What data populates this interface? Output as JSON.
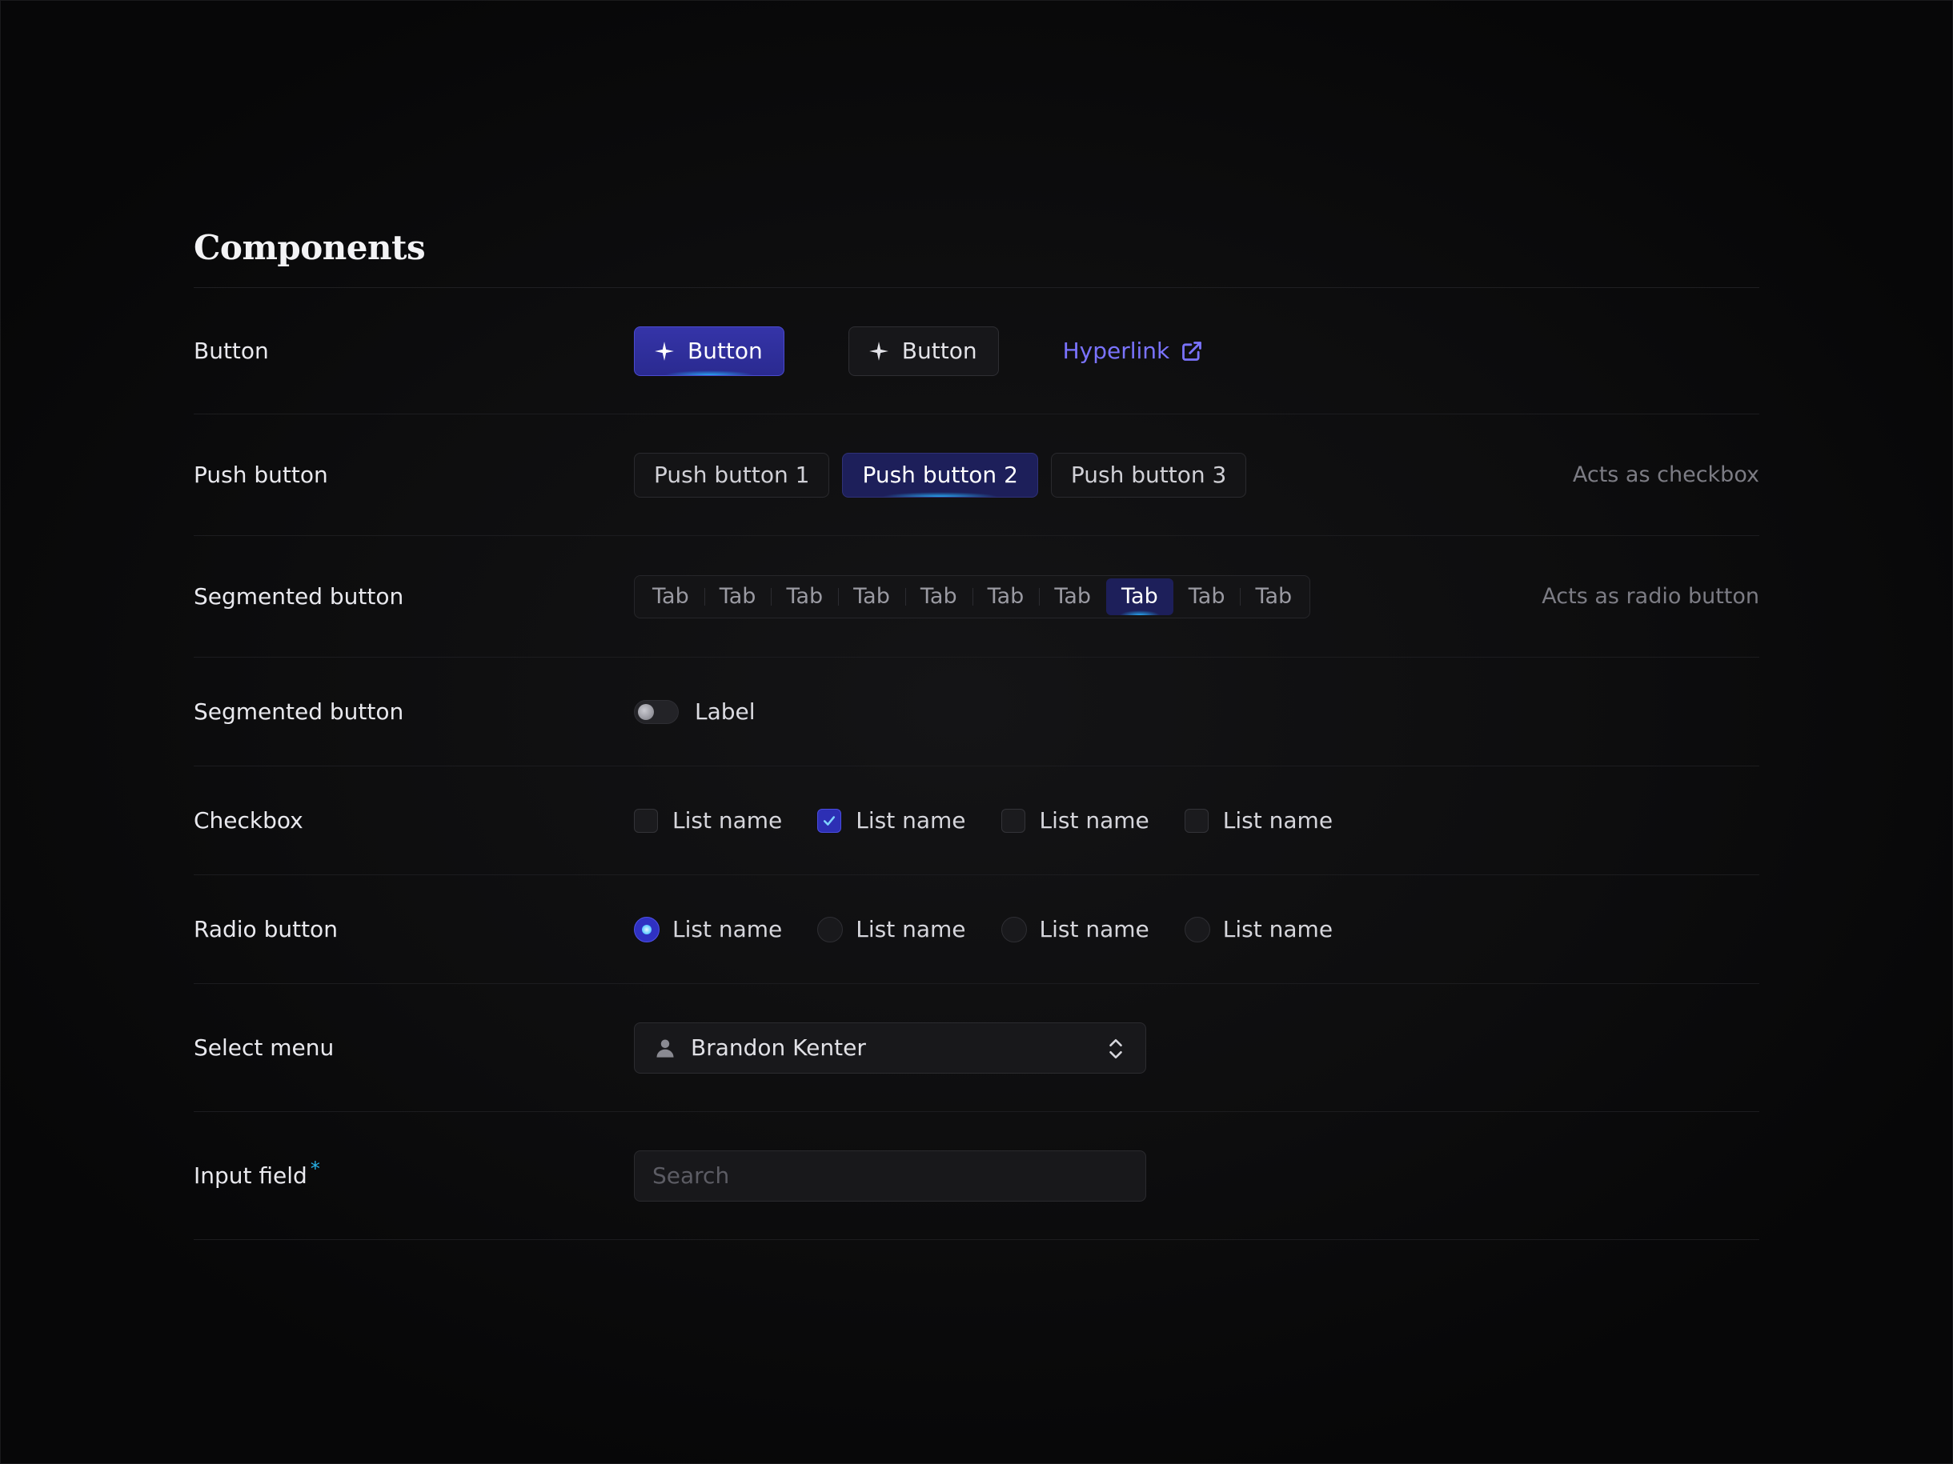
{
  "page": {
    "title": "Components"
  },
  "rows": {
    "button": {
      "label": "Button",
      "primary_label": "Button",
      "secondary_label": "Button",
      "link_label": "Hyperlink"
    },
    "push": {
      "label": "Push button",
      "items": [
        "Push button 1",
        "Push button 2",
        "Push button 3"
      ],
      "selected_index": 1,
      "note": "Acts as checkbox"
    },
    "segmented": {
      "label": "Segmented button",
      "tabs": [
        "Tab",
        "Tab",
        "Tab",
        "Tab",
        "Tab",
        "Tab",
        "Tab",
        "Tab",
        "Tab",
        "Tab"
      ],
      "selected_index": 7,
      "note": "Acts as radio button"
    },
    "toggle": {
      "label": "Segmented button",
      "toggle_label": "Label",
      "on": false
    },
    "checkbox": {
      "label": "Checkbox",
      "items": [
        "List name",
        "List name",
        "List name",
        "List name"
      ],
      "checked": [
        false,
        true,
        false,
        false
      ]
    },
    "radio": {
      "label": "Radio button",
      "items": [
        "List name",
        "List name",
        "List name",
        "List name"
      ],
      "selected_index": 0
    },
    "select": {
      "label": "Select menu",
      "value": "Brandon Kenter"
    },
    "input": {
      "label": "Input field",
      "required_mark": "*",
      "placeholder": "Search",
      "value": ""
    }
  },
  "colors": {
    "accent": "#2d2fb4",
    "link": "#7a73ff",
    "glow": "#28b4ff",
    "required": "#29b2e8"
  },
  "icons": {
    "primary_button": "sparkle-icon",
    "secondary_button": "sparkle-icon",
    "hyperlink": "external-link-icon",
    "select_leading": "person-icon",
    "select_trailing": "chevron-up-down-icon",
    "checkbox_checked": "checkmark-icon"
  }
}
